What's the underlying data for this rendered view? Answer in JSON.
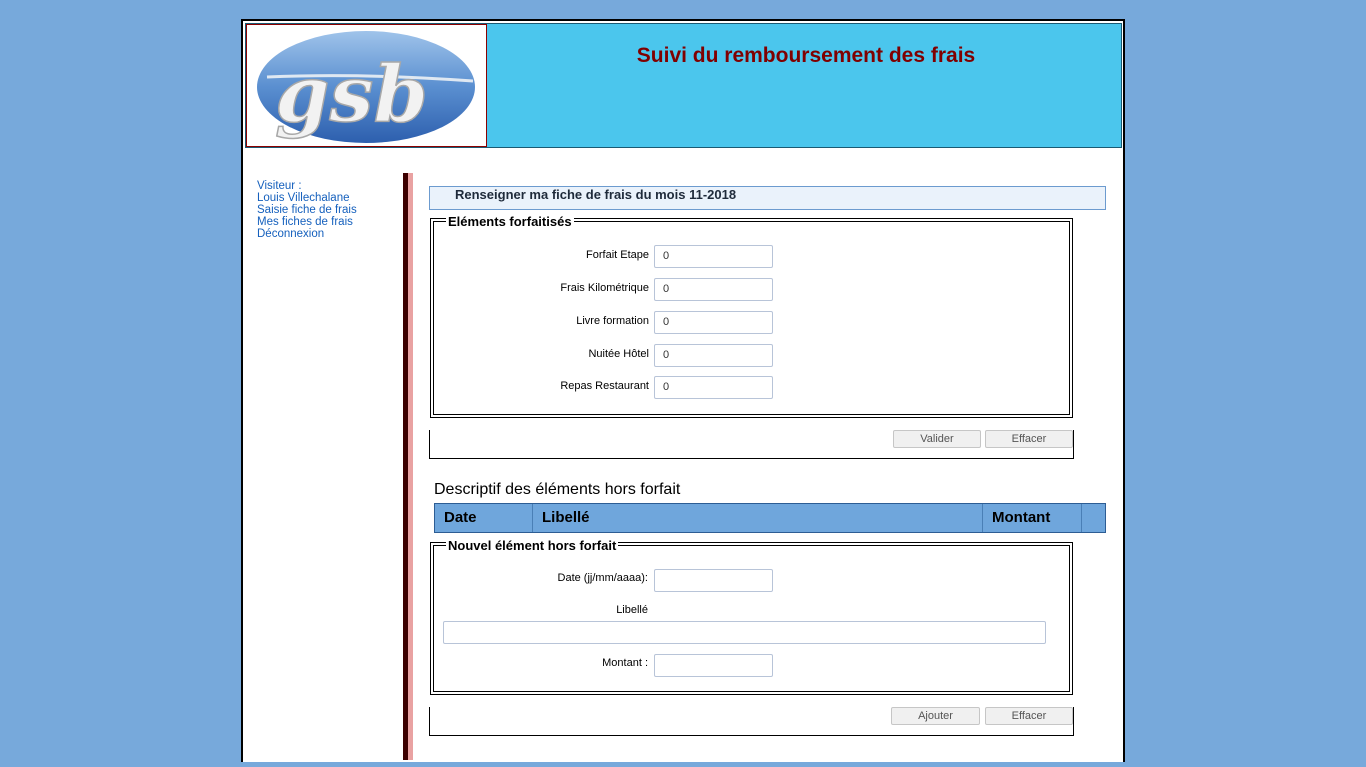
{
  "header": {
    "logo_text": "gsb",
    "title": "Suivi du remboursement des frais"
  },
  "sidebar": {
    "visitor_label": "Visiteur :",
    "visitor_name": "Louis Villechalane",
    "links": [
      "Saisie fiche de frais",
      "Mes fiches de frais",
      "Déconnexion"
    ]
  },
  "main": {
    "month_title": "Renseigner ma fiche de frais du mois 11-2018",
    "forfait": {
      "legend": "Eléments forfaitisés",
      "fields": [
        {
          "label": "Forfait Etape",
          "value": "0"
        },
        {
          "label": "Frais Kilométrique",
          "value": "0"
        },
        {
          "label": "Livre formation",
          "value": "0"
        },
        {
          "label": "Nuitée Hôtel",
          "value": "0"
        },
        {
          "label": "Repas Restaurant",
          "value": "0"
        }
      ],
      "validate_label": "Valider",
      "reset_label": "Effacer"
    },
    "hors_forfait": {
      "title": "Descriptif des éléments hors forfait",
      "columns": [
        "Date",
        "Libellé",
        "Montant"
      ]
    },
    "nouvel_element": {
      "legend": "Nouvel élément hors forfait",
      "date_label": "Date (jj/mm/aaaa):",
      "libelle_label": "Libellé",
      "montant_label": "Montant :",
      "add_label": "Ajouter",
      "reset_label": "Effacer"
    }
  },
  "colors": {
    "background": "#77a9db",
    "header_bg": "#4bc6ed",
    "title": "#800000",
    "link": "#1560bd",
    "table_header": "#6fa6dc"
  }
}
